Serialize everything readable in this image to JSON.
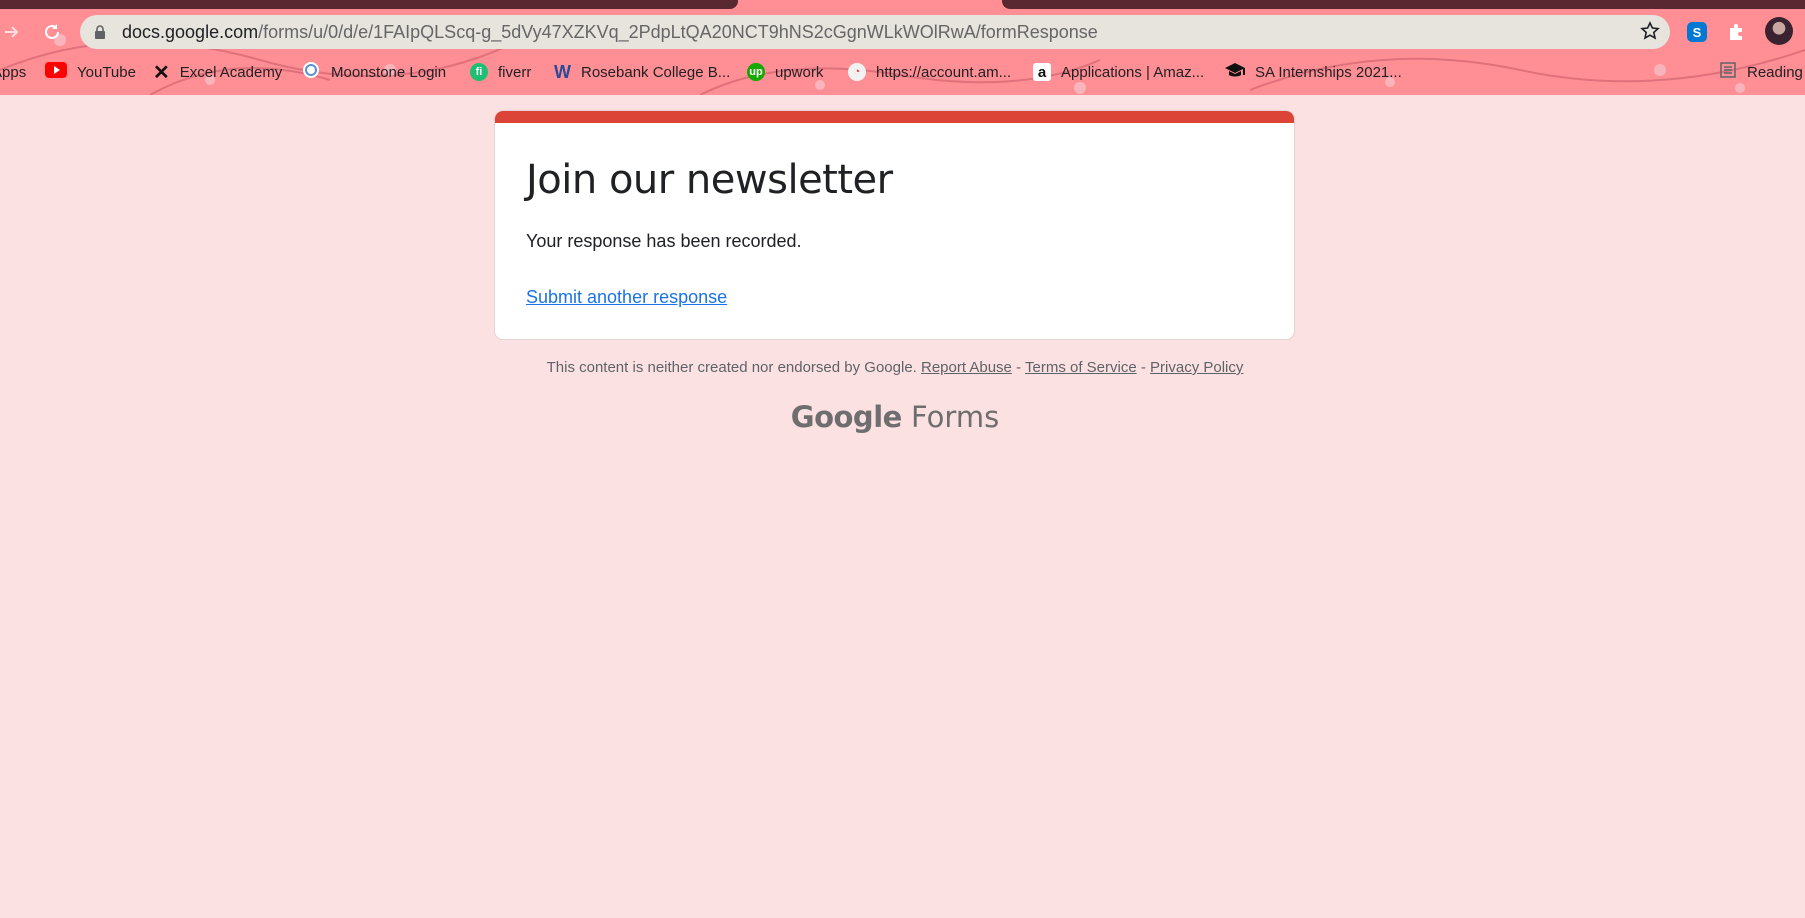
{
  "browser": {
    "url_host": "docs.google.com",
    "url_path": "/forms/u/0/d/e/1FAIpQLScq-g_5dVy47XZKVq_2PdpLtQA20NCT9hNS2cGgnWLkWOlRwA/formResponse",
    "bookmarks": [
      {
        "label": "Apps",
        "icon": "apps-icon"
      },
      {
        "label": "YouTube",
        "icon": "youtube-icon",
        "color": "#ff0000"
      },
      {
        "label": "Excel Academy",
        "icon": "excel-academy-x-icon"
      },
      {
        "label": "Moonstone Login",
        "icon": "moonstone-icon"
      },
      {
        "label": "fiverr",
        "icon": "fiverr-icon",
        "color": "#1dbf73"
      },
      {
        "label": "Rosebank College B...",
        "icon": "rosebank-w-icon"
      },
      {
        "label": "upwork",
        "icon": "upwork-icon",
        "color": "#14a800"
      },
      {
        "label": "https://account.am...",
        "icon": "globe-icon"
      },
      {
        "label": "Applications | Amaz...",
        "icon": "amazon-icon"
      },
      {
        "label": "SA Internships 2021...",
        "icon": "graduation-cap-icon"
      },
      {
        "label": "Reading",
        "icon": "reading-list-icon"
      }
    ]
  },
  "form": {
    "title": "Join our newsletter",
    "message": "Your response has been recorded.",
    "link": "Submit another response",
    "accent_color": "#db4437"
  },
  "footer": {
    "disclaimer": "This content is neither created nor endorsed by Google.",
    "report_abuse": "Report Abuse",
    "sep1": "-",
    "terms": "Terms of Service",
    "sep2": "-",
    "privacy": "Privacy Policy"
  },
  "brand": {
    "google": "Google",
    "forms": "Forms"
  }
}
